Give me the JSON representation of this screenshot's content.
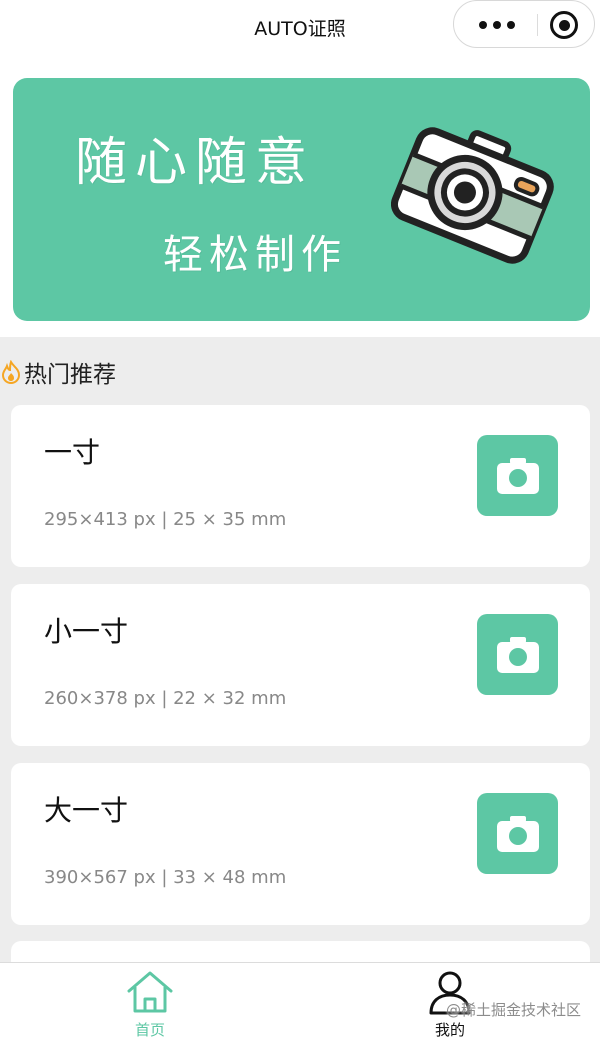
{
  "header": {
    "title": "AUTO证照",
    "more_icon": "more-dots-icon",
    "close_icon": "target-close-icon"
  },
  "banner": {
    "line1": "随心随意",
    "line2": "轻松制作",
    "icon": "camera-illustration",
    "background_color": "#5dc7a4"
  },
  "section": {
    "icon": "flame-icon",
    "title": "热门推荐"
  },
  "cards": [
    {
      "name": "一寸",
      "spec": "295×413 px | 25 × 35 mm",
      "icon": "camera-icon"
    },
    {
      "name": "小一寸",
      "spec": "260×378 px | 22 × 32 mm",
      "icon": "camera-icon"
    },
    {
      "name": "大一寸",
      "spec": "390×567 px | 33 × 48 mm",
      "icon": "camera-icon"
    }
  ],
  "tabbar": {
    "items": [
      {
        "label": "首页",
        "icon": "home-icon",
        "active": true
      },
      {
        "label": "我的",
        "icon": "user-icon",
        "active": false
      }
    ]
  },
  "watermark": "@稀土掘金技术社区",
  "colors": {
    "accent": "#5dc7a4",
    "section_icon": "#f5a623",
    "page_background": "#ededed"
  }
}
